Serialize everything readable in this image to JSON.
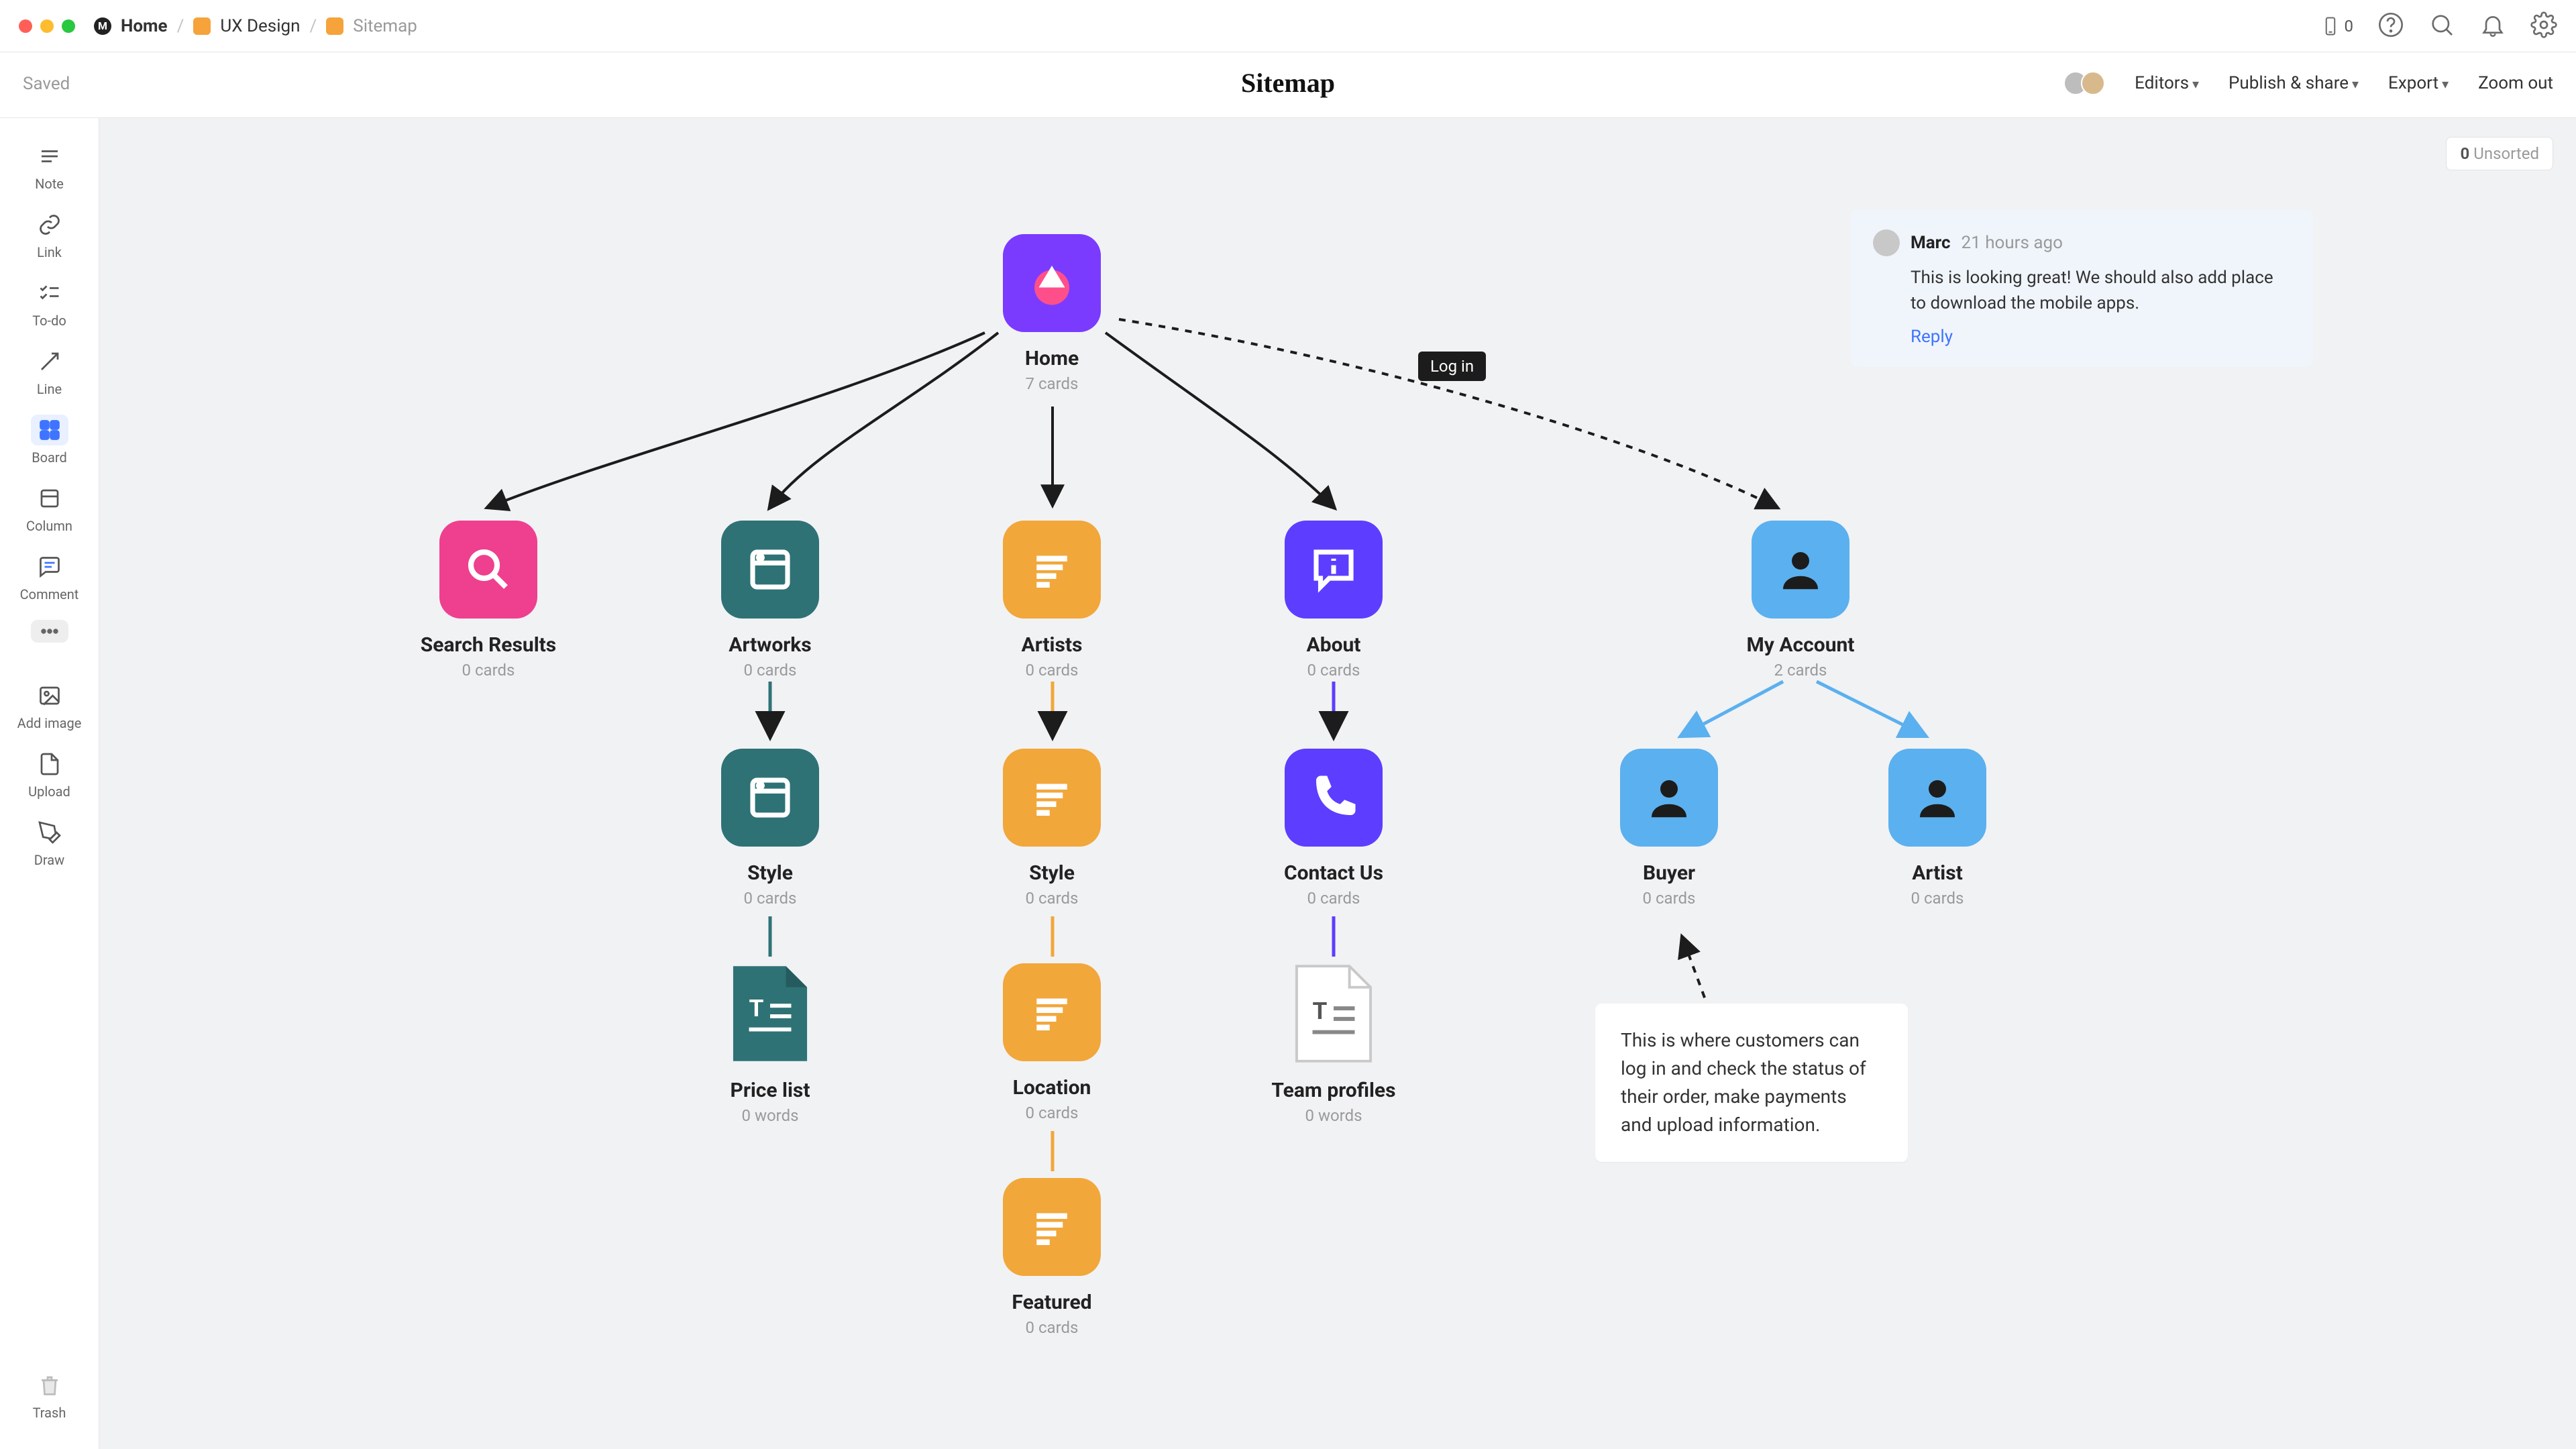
{
  "breadcrumbs": {
    "home": "Home",
    "ux": "UX Design",
    "sitemap": "Sitemap"
  },
  "mobile_count": "0",
  "saved": "Saved",
  "page_title": "Sitemap",
  "header": {
    "editors": "Editors",
    "publish": "Publish & share",
    "export": "Export",
    "zoomout": "Zoom out"
  },
  "tools": {
    "note": "Note",
    "link": "Link",
    "todo": "To-do",
    "line": "Line",
    "board": "Board",
    "column": "Column",
    "comment": "Comment",
    "addimage": "Add image",
    "upload": "Upload",
    "draw": "Draw",
    "trash": "Trash"
  },
  "unsorted": {
    "count": "0",
    "label": "Unsorted"
  },
  "nodes": {
    "home": {
      "title": "Home",
      "sub": "7 cards"
    },
    "search": {
      "title": "Search Results",
      "sub": "0 cards"
    },
    "artworks": {
      "title": "Artworks",
      "sub": "0 cards"
    },
    "artists": {
      "title": "Artists",
      "sub": "0 cards"
    },
    "about": {
      "title": "About",
      "sub": "0 cards"
    },
    "myacct": {
      "title": "My Account",
      "sub": "2 cards"
    },
    "style_a": {
      "title": "Style",
      "sub": "0 cards"
    },
    "style_b": {
      "title": "Style",
      "sub": "0 cards"
    },
    "contact": {
      "title": "Contact Us",
      "sub": "0 cards"
    },
    "buyer": {
      "title": "Buyer",
      "sub": "0 cards"
    },
    "artist": {
      "title": "Artist",
      "sub": "0 cards"
    },
    "price": {
      "title": "Price list",
      "sub": "0 words"
    },
    "location": {
      "title": "Location",
      "sub": "0 cards"
    },
    "team": {
      "title": "Team profiles",
      "sub": "0 words"
    },
    "featured": {
      "title": "Featured",
      "sub": "0 cards"
    }
  },
  "login_tag": "Log in",
  "comment": {
    "author": "Marc",
    "time": "21 hours ago",
    "body": "This is looking great! We should also add place to download the mobile apps.",
    "reply": "Reply"
  },
  "buyer_note": "This is where customers can log in and check the status of their order, make payments and upload information."
}
